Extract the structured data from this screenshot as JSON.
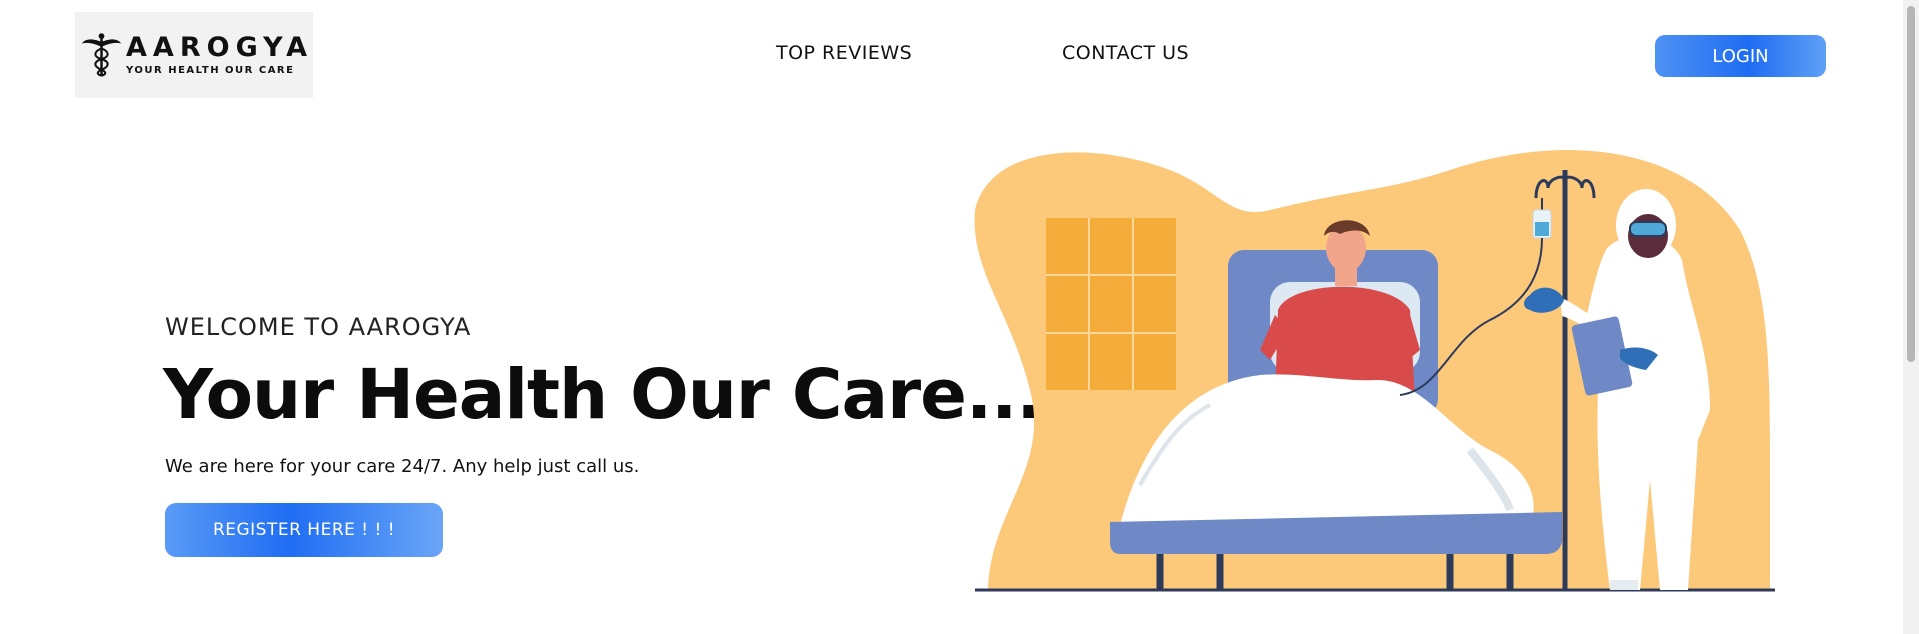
{
  "header": {
    "brand_name": "AAROGYA",
    "brand_tagline": "YOUR HEALTH OUR CARE",
    "nav": [
      {
        "label": "TOP REVIEWS"
      },
      {
        "label": "CONTACT US"
      }
    ],
    "login_label": "LOGIN"
  },
  "hero": {
    "eyebrow": "WELCOME TO AAROGYA",
    "headline": "Your Health Our Care...",
    "subtext": "We are here for your care 24/7. Any help just call us.",
    "register_label": "REGISTER HERE ! ! !"
  },
  "icons": {
    "logo": "caduceus-icon",
    "illustration": "hospital-bed-patient-doctor-illustration"
  },
  "colors": {
    "accent_blue": "#1e6cf2",
    "illustration_orange": "#fcc97b"
  }
}
